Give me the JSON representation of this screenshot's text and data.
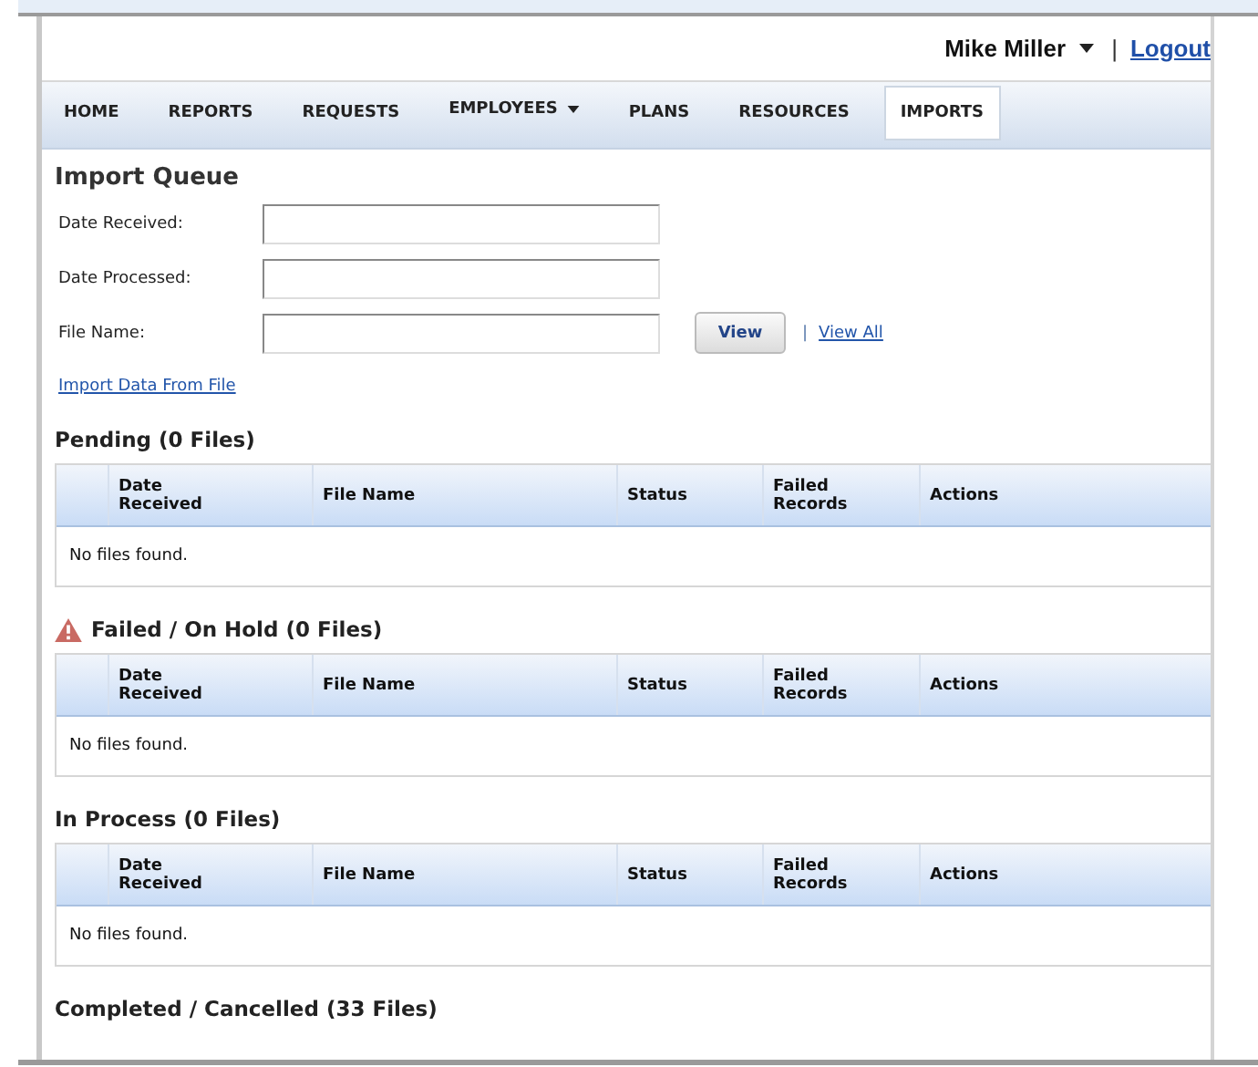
{
  "user_menu": {
    "name": "Mike Miller",
    "separator": "|",
    "logout": "Logout"
  },
  "nav": [
    {
      "label": "HOME",
      "selected": false,
      "dropdown": false
    },
    {
      "label": "REPORTS",
      "selected": false,
      "dropdown": false
    },
    {
      "label": "REQUESTS",
      "selected": false,
      "dropdown": false
    },
    {
      "label": "EMPLOYEES",
      "selected": false,
      "dropdown": true
    },
    {
      "label": "PLANS",
      "selected": false,
      "dropdown": false
    },
    {
      "label": "RESOURCES",
      "selected": false,
      "dropdown": false
    },
    {
      "label": "IMPORTS",
      "selected": true,
      "dropdown": false
    }
  ],
  "import_queue": {
    "title": "Import Queue",
    "fields": [
      {
        "label": "Date Received:"
      },
      {
        "label": "Date Processed:"
      },
      {
        "label": "File Name:"
      }
    ],
    "view_button": "View",
    "separator": "|",
    "view_all": "View All",
    "import_link": "Import Data From File"
  },
  "sections": [
    {
      "title": "Pending (0 Files)",
      "warning": false,
      "columns": [
        "Date Received",
        "File Name",
        "Status",
        "Failed Records",
        "Actions"
      ],
      "empty_text": "No files found."
    },
    {
      "title": "Failed / On Hold (0 Files)",
      "warning": true,
      "columns": [
        "Date Received",
        "File Name",
        "Status",
        "Failed Records",
        "Actions"
      ],
      "empty_text": "No files found."
    },
    {
      "title": "In Process (0 Files)",
      "warning": false,
      "columns": [
        "Date Received",
        "File Name",
        "Status",
        "Failed Records",
        "Actions"
      ],
      "empty_text": "No files found."
    },
    {
      "title": "Completed / Cancelled (33 Files)",
      "warning": false
    }
  ]
}
